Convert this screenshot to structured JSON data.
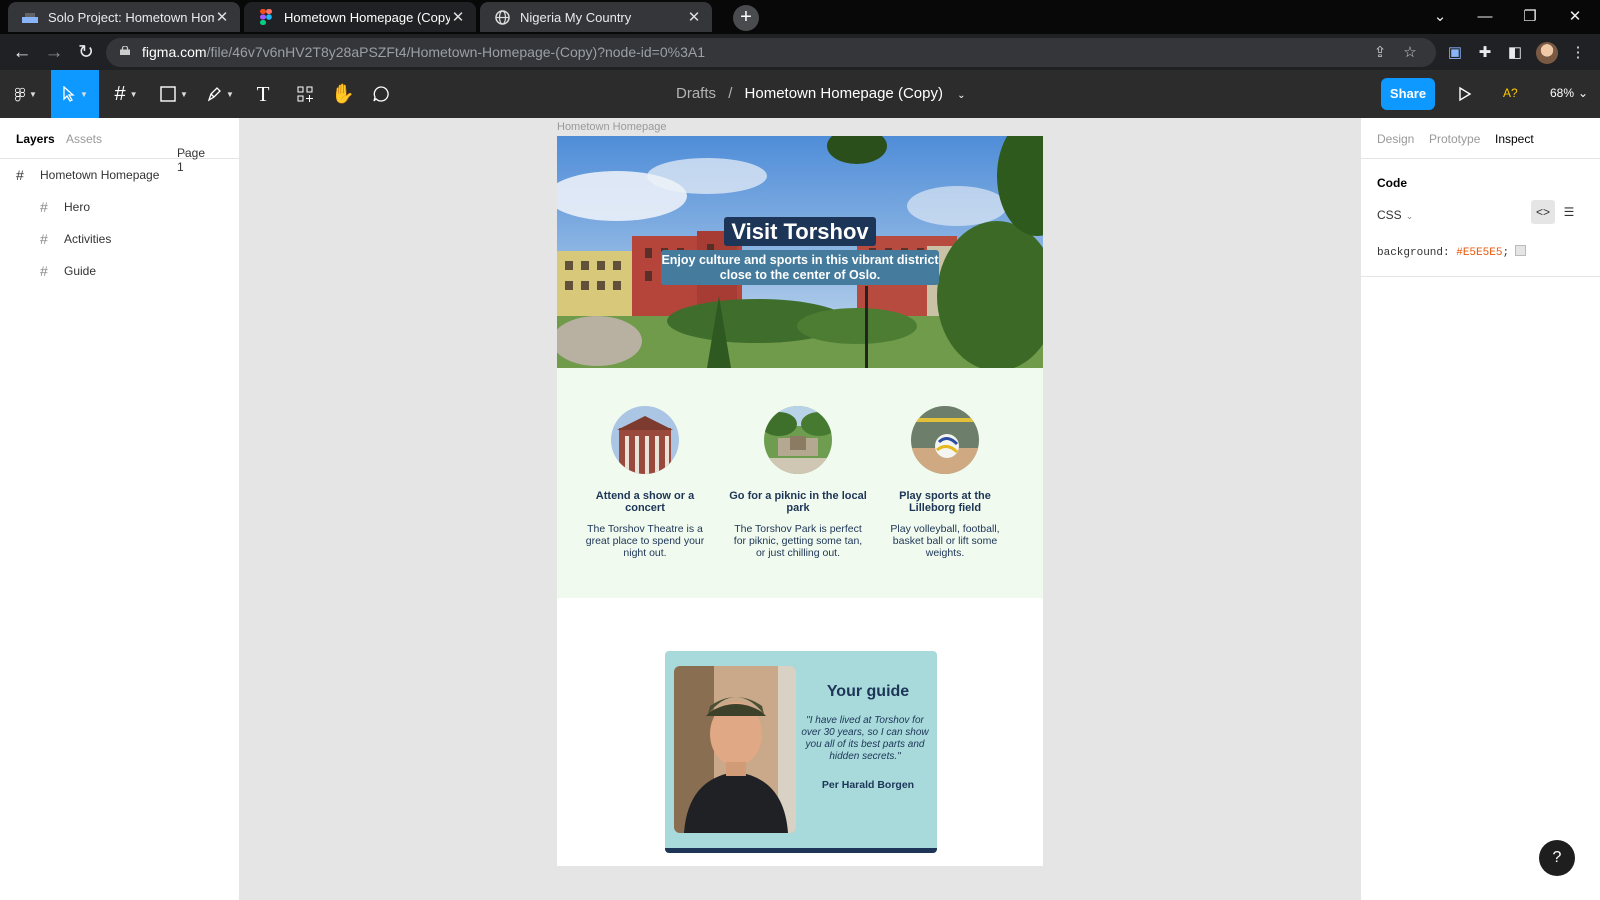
{
  "browser": {
    "tabs": [
      {
        "title": "Solo Project: Hometown Homep",
        "active": false
      },
      {
        "title": "Hometown Homepage (Copy) – F",
        "active": true
      },
      {
        "title": "Nigeria My Country",
        "active": false
      }
    ],
    "url_host": "figma.com",
    "url_path": "/file/46v7v6nHV2T8y28aPSZFt4/Hometown-Homepage-(Copy)?node-id=0%3A1"
  },
  "toolbar": {
    "breadcrumb_parent": "Drafts",
    "breadcrumb_sep": "/",
    "file_name": "Hometown Homepage (Copy)",
    "share_label": "Share",
    "ai_label": "A?",
    "zoom": "68%"
  },
  "left_panel": {
    "tabs": [
      "Layers",
      "Assets"
    ],
    "page": "Page 1",
    "layers": [
      {
        "name": "Hometown Homepage",
        "level": 0
      },
      {
        "name": "Hero",
        "level": 1
      },
      {
        "name": "Activities",
        "level": 1
      },
      {
        "name": "Guide",
        "level": 1
      }
    ]
  },
  "canvas": {
    "frame_label": "Hometown Homepage",
    "hero": {
      "title": "Visit Torshov",
      "subtitle": "Enjoy culture and sports in this vibrant district close to the center of Oslo."
    },
    "activities": [
      {
        "heading": "Attend a show or a concert",
        "text": "The Torshov Theatre is a great place to spend your night out."
      },
      {
        "heading": "Go for a piknic in the local park",
        "text": "The Torshov Park is perfect for piknic, getting some tan, or just chilling out."
      },
      {
        "heading": "Play sports at the Lilleborg field",
        "text": "Play volleyball, football, basket ball or lift some weights."
      }
    ],
    "guide": {
      "title": "Your guide",
      "quote": "\"I have lived at Torshov for over 30 years, so I can show you all of its best parts and hidden secrets.\"",
      "name": "Per Harald Borgen"
    }
  },
  "right_panel": {
    "tabs": [
      "Design",
      "Prototype",
      "Inspect"
    ],
    "active_tab": "Inspect",
    "code_heading": "Code",
    "language": "CSS",
    "css_property": "background:",
    "css_value": "#E5E5E5",
    "css_end": ";"
  },
  "help_label": "?",
  "colors": {
    "figma_blue": "#0d99ff",
    "navy": "#1d3557",
    "steel": "#457b9d",
    "mint": "#f1faee",
    "teal": "#a8dadc",
    "canvas_bg": "#e5e5e5"
  }
}
